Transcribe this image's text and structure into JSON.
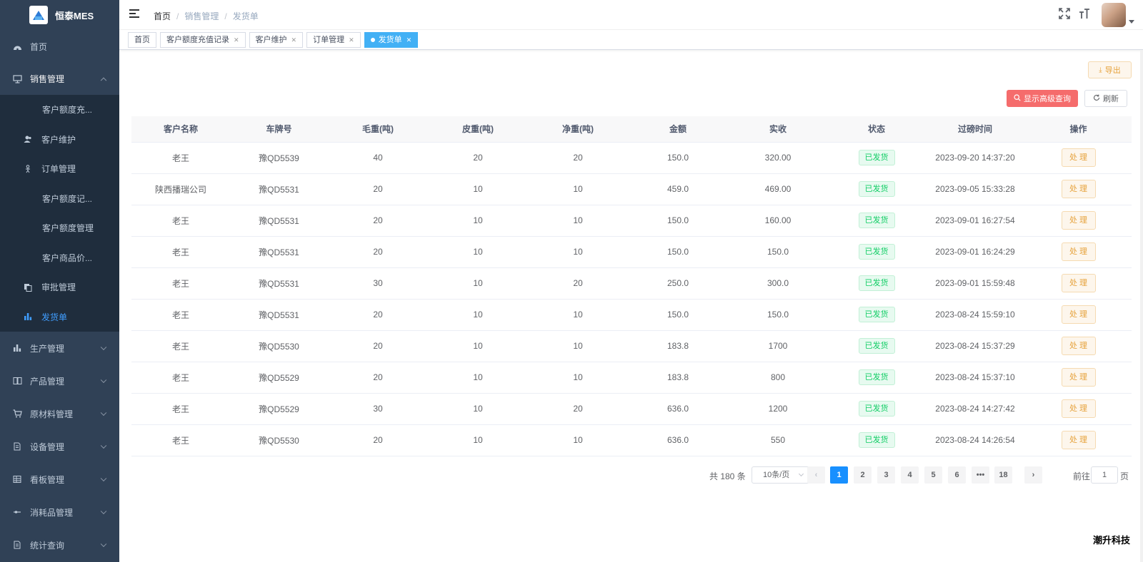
{
  "app": {
    "title": "恒泰MES"
  },
  "sidebar": {
    "home": "首页",
    "sales": "销售管理",
    "sales_items": [
      {
        "label": "客户额度充...",
        "icon": "none",
        "active": false
      },
      {
        "label": "客户维护",
        "icon": "user-icon",
        "active": false
      },
      {
        "label": "订单管理",
        "icon": "person-icon",
        "active": false
      },
      {
        "label": "客户额度记...",
        "icon": "none",
        "active": false
      },
      {
        "label": "客户额度管理",
        "icon": "none",
        "active": false
      },
      {
        "label": "客户商品价...",
        "icon": "none",
        "active": false
      },
      {
        "label": "审批管理",
        "icon": "copy-icon",
        "active": false
      },
      {
        "label": "发货单",
        "icon": "chart-icon",
        "active": true
      }
    ],
    "groups": [
      "生产管理",
      "产品管理",
      "原材料管理",
      "设备管理",
      "看板管理",
      "消耗品管理",
      "统计查询"
    ]
  },
  "breadcrumb": [
    "首页",
    "销售管理",
    "发货单"
  ],
  "tags": [
    "首页",
    "客户额度充值记录",
    "客户维护",
    "订单管理",
    "发货单"
  ],
  "toolbar": {
    "export": "导出",
    "query": "显示高级查询",
    "refresh": "刷新"
  },
  "table": {
    "headers": [
      "客户名称",
      "车牌号",
      "毛重(吨)",
      "皮重(吨)",
      "净重(吨)",
      "金额",
      "实收",
      "状态",
      "过磅时间",
      "操作"
    ],
    "rows": [
      [
        "老王",
        "豫QD5539",
        "40",
        "20",
        "20",
        "150.0",
        "320.00",
        "已发货",
        "2023-09-20 14:37:20",
        "处 理"
      ],
      [
        "陕西播瑞公司",
        "豫QD5531",
        "20",
        "10",
        "10",
        "459.0",
        "469.00",
        "已发货",
        "2023-09-05 15:33:28",
        "处 理"
      ],
      [
        "老王",
        "豫QD5531",
        "20",
        "10",
        "10",
        "150.0",
        "160.00",
        "已发货",
        "2023-09-01 16:27:54",
        "处 理"
      ],
      [
        "老王",
        "豫QD5531",
        "20",
        "10",
        "10",
        "150.0",
        "150.0",
        "已发货",
        "2023-09-01 16:24:29",
        "处 理"
      ],
      [
        "老王",
        "豫QD5531",
        "30",
        "10",
        "20",
        "250.0",
        "300.0",
        "已发货",
        "2023-09-01 15:59:48",
        "处 理"
      ],
      [
        "老王",
        "豫QD5531",
        "20",
        "10",
        "10",
        "150.0",
        "150.0",
        "已发货",
        "2023-08-24 15:59:10",
        "处 理"
      ],
      [
        "老王",
        "豫QD5530",
        "20",
        "10",
        "10",
        "183.8",
        "1700",
        "已发货",
        "2023-08-24 15:37:29",
        "处 理"
      ],
      [
        "老王",
        "豫QD5529",
        "20",
        "10",
        "10",
        "183.8",
        "800",
        "已发货",
        "2023-08-24 15:37:10",
        "处 理"
      ],
      [
        "老王",
        "豫QD5529",
        "30",
        "10",
        "20",
        "636.0",
        "1200",
        "已发货",
        "2023-08-24 14:27:42",
        "处 理"
      ],
      [
        "老王",
        "豫QD5530",
        "20",
        "10",
        "10",
        "636.0",
        "550",
        "已发货",
        "2023-08-24 14:26:54",
        "处 理"
      ]
    ]
  },
  "pagination": {
    "total": "共 180 条",
    "page_size": "10条/页",
    "pages": [
      "1",
      "2",
      "3",
      "4",
      "5",
      "6",
      "•••",
      "18"
    ],
    "current": "1",
    "goto_label": "前往",
    "goto_value": "1",
    "page_suffix": "页"
  },
  "watermark": "潮升科技"
}
